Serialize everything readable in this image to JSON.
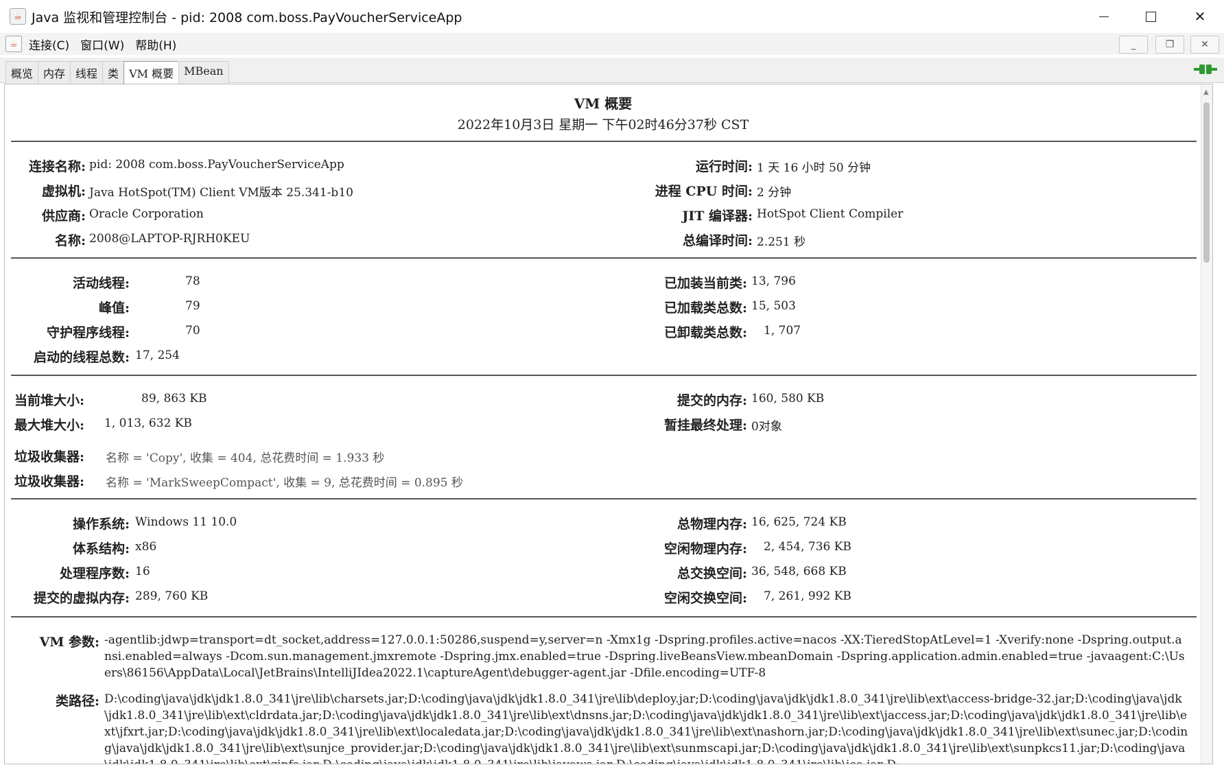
{
  "window": {
    "title": "Java 监视和管理控制台 - pid: 2008 com.boss.PayVoucherServiceApp",
    "min": "—",
    "max": "□",
    "close": "✕"
  },
  "menu": {
    "connect": "连接(C)",
    "window": "窗口(W)",
    "help": "帮助(H)"
  },
  "tabs": [
    "概览",
    "内存",
    "线程",
    "类",
    "VM 概要",
    "MBean"
  ],
  "header": {
    "title": "VM 概要",
    "date": "2022年10月3日 星期一 下午02时46分37秒 CST"
  },
  "section1": {
    "left": [
      {
        "label": "连接名称:",
        "value": "pid: 2008 com.boss.PayVoucherServiceApp"
      },
      {
        "label": "虚拟机:",
        "value": "Java HotSpot(TM) Client VM版本 25.341-b10"
      },
      {
        "label": "供应商:",
        "value": "Oracle Corporation"
      },
      {
        "label": "名称:",
        "value": "2008@LAPTOP-RJRH0KEU"
      }
    ],
    "right": [
      {
        "label": "运行时间:",
        "value": "1 天 16 小时 50 分钟"
      },
      {
        "label": "进程 CPU 时间:",
        "value": "2 分钟"
      },
      {
        "label": "JIT 编译器:",
        "value": "HotSpot Client Compiler"
      },
      {
        "label": "总编译时间:",
        "value": "2.251 秒"
      }
    ]
  },
  "section2": {
    "left": [
      {
        "label": "活动线程:",
        "value": "78"
      },
      {
        "label": "峰值:",
        "value": "79"
      },
      {
        "label": "守护程序线程:",
        "value": "70"
      },
      {
        "label": "启动的线程总数:",
        "value": "17, 254"
      }
    ],
    "right": [
      {
        "label": "已加装当前类:",
        "value": "13, 796"
      },
      {
        "label": "已加载类总数:",
        "value": "15, 503"
      },
      {
        "label": "已卸载类总数:",
        "value": "1, 707"
      }
    ]
  },
  "section3": {
    "left": [
      {
        "label": "当前堆大小:",
        "value": "89, 863 KB"
      },
      {
        "label": "最大堆大小:",
        "value": "1, 013, 632 KB"
      }
    ],
    "right": [
      {
        "label": "提交的内存:",
        "value": "160, 580 KB"
      },
      {
        "label": "暂挂最终处理:",
        "value": "0对象"
      }
    ],
    "gc": [
      {
        "label": "垃圾收集器:",
        "value": "名称 = 'Copy', 收集 = 404, 总花费时间 = 1.933 秒"
      },
      {
        "label": "垃圾收集器:",
        "value": "名称 = 'MarkSweepCompact', 收集 = 9, 总花费时间 = 0.895 秒"
      }
    ]
  },
  "section4": {
    "left": [
      {
        "label": "操作系统:",
        "value": "Windows 11 10.0"
      },
      {
        "label": "体系结构:",
        "value": "x86"
      },
      {
        "label": "处理程序数:",
        "value": "16"
      },
      {
        "label": "提交的虚拟内存:",
        "value": "289, 760 KB"
      }
    ],
    "right": [
      {
        "label": "总物理内存:",
        "value": "16, 625, 724 KB"
      },
      {
        "label": "空闲物理内存:",
        "value": "2, 454, 736 KB"
      },
      {
        "label": "总交换空间:",
        "value": "36, 548, 668 KB"
      },
      {
        "label": "空闲交换空间:",
        "value": "7, 261, 992 KB"
      }
    ]
  },
  "section5": {
    "vm_args_label": "VM 参数:",
    "vm_args": "-agentlib:jdwp=transport=dt_socket,address=127.0.0.1:50286,suspend=y,server=n -Xmx1g -Dspring.profiles.active=nacos -XX:TieredStopAtLevel=1 -Xverify:none -Dspring.output.ansi.enabled=always -Dcom.sun.management.jmxremote -Dspring.jmx.enabled=true -Dspring.liveBeansView.mbeanDomain -Dspring.application.admin.enabled=true -javaagent:C:\\Users\\86156\\AppData\\Local\\JetBrains\\IntelliJIdea2022.1\\captureAgent\\debugger-agent.jar -Dfile.encoding=UTF-8",
    "classpath_label": "类路径:",
    "classpath": "D:\\coding\\java\\jdk\\jdk1.8.0_341\\jre\\lib\\charsets.jar;D:\\coding\\java\\jdk\\jdk1.8.0_341\\jre\\lib\\deploy.jar;D:\\coding\\java\\jdk\\jdk1.8.0_341\\jre\\lib\\ext\\access-bridge-32.jar;D:\\coding\\java\\jdk\\jdk1.8.0_341\\jre\\lib\\ext\\cldrdata.jar;D:\\coding\\java\\jdk\\jdk1.8.0_341\\jre\\lib\\ext\\dnsns.jar;D:\\coding\\java\\jdk\\jdk1.8.0_341\\jre\\lib\\ext\\jaccess.jar;D:\\coding\\java\\jdk\\jdk1.8.0_341\\jre\\lib\\ext\\jfxrt.jar;D:\\coding\\java\\jdk\\jdk1.8.0_341\\jre\\lib\\ext\\localedata.jar;D:\\coding\\java\\jdk\\jdk1.8.0_341\\jre\\lib\\ext\\nashorn.jar;D:\\coding\\java\\jdk\\jdk1.8.0_341\\jre\\lib\\ext\\sunec.jar;D:\\coding\\java\\jdk\\jdk1.8.0_341\\jre\\lib\\ext\\sunjce_provider.jar;D:\\coding\\java\\jdk\\jdk1.8.0_341\\jre\\lib\\ext\\sunmscapi.jar;D:\\coding\\java\\jdk\\jdk1.8.0_341\\jre\\lib\\ext\\sunpkcs11.jar;D:\\coding\\java\\jdk\\jdk1.8.0_341\\jre\\lib\\ext\\zipfs.jar;D:\\coding\\java\\jdk\\jdk1.8.0_341\\jre\\lib\\javaws.jar;D:\\coding\\java\\jdk\\jdk1.8.0_341\\jre\\lib\\jce.jar;D:"
  },
  "colors": {
    "accent_plug": "#2e9a2e",
    "separator": "#555555"
  }
}
